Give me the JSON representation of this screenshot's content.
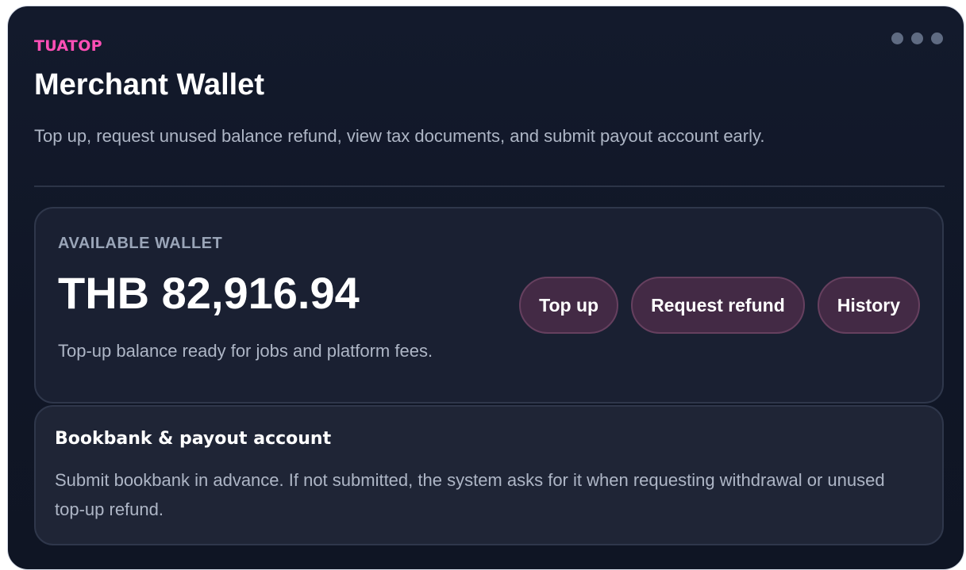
{
  "header": {
    "brand": "TUATOP",
    "title": "Merchant Wallet",
    "subtitle": "Top up, request unused balance refund, view tax documents, and submit payout account early.",
    "menu_icon": "more-dots-icon"
  },
  "wallet": {
    "label": "AVAILABLE WALLET",
    "amount": "THB 82,916.94",
    "note": "Top-up balance ready for jobs and platform fees.",
    "actions": {
      "top_up": "Top up",
      "request_refund": "Request refund",
      "history": "History"
    }
  },
  "bankbook": {
    "title": "Bookbank & payout account",
    "description": "Submit bookbank in advance. If not submitted, the system asks for it when requesting withdrawal or unused top-up refund."
  },
  "colors": {
    "brand": "#ff4fb6",
    "background": "#111827",
    "button": "#432a45"
  }
}
